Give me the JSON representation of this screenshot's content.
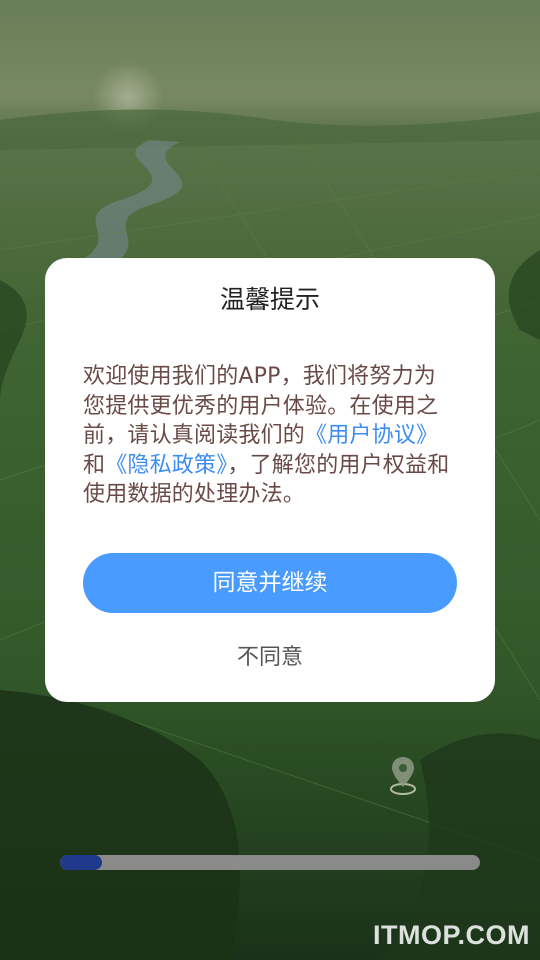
{
  "dialog": {
    "title": "温馨提示",
    "body_part1": "欢迎使用我们的APP，我们将努力为您提供更优秀的用户体验。在使用之前，请认真阅读我们的",
    "user_agreement_link": "《用户协议》",
    "body_part2": "和",
    "privacy_link": "《隐私政策》",
    "body_part3": "，了解您的用户权益和使用数据的处理办法。",
    "agree_label": "同意并继续",
    "disagree_label": "不同意"
  },
  "loading": {
    "progress_fraction": 0.1
  },
  "watermark": "ITMOP.COM",
  "icons": {
    "map_pin": "location-pin-icon"
  },
  "colors": {
    "accent": "#4a9bff",
    "link": "#3d8df2",
    "progress_fill": "#1f3a8a",
    "progress_track": "#8a8a8a"
  }
}
